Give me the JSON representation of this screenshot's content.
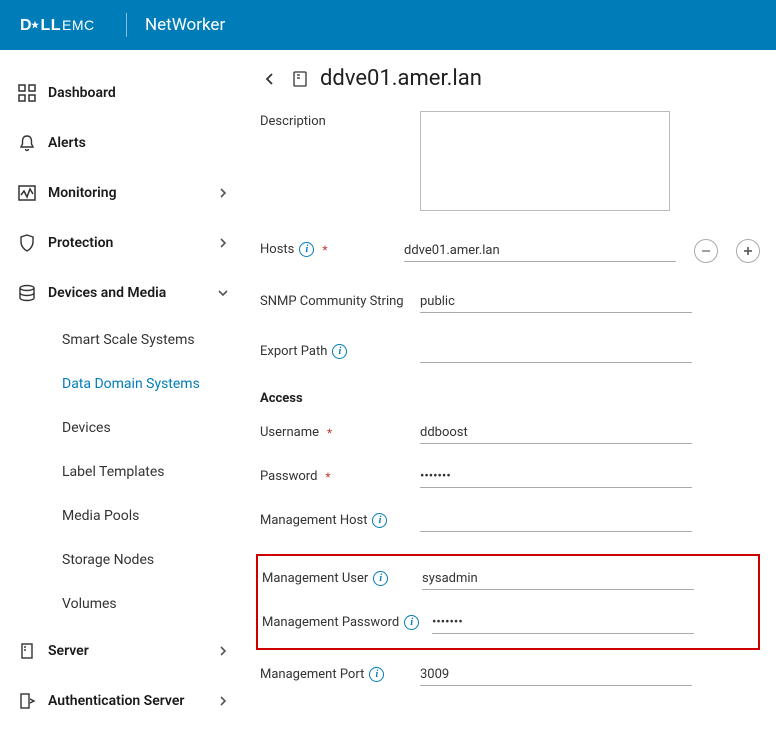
{
  "header": {
    "brand_main": "D",
    "brand_rest": "LLEMC",
    "product": "NetWorker"
  },
  "sidebar": {
    "items": [
      {
        "label": "Dashboard",
        "expandable": false
      },
      {
        "label": "Alerts",
        "expandable": false
      },
      {
        "label": "Monitoring",
        "expandable": true
      },
      {
        "label": "Protection",
        "expandable": true
      },
      {
        "label": "Devices and Media",
        "expandable": true,
        "expanded": true
      },
      {
        "label": "Server",
        "expandable": true
      },
      {
        "label": "Authentication Server",
        "expandable": true
      }
    ],
    "devices_sub": [
      "Smart Scale Systems",
      "Data Domain Systems",
      "Devices",
      "Label Templates",
      "Media Pools",
      "Storage Nodes",
      "Volumes"
    ],
    "active_sub": "Data Domain Systems"
  },
  "main": {
    "title": "ddve01.amer.lan",
    "form": {
      "description_label": "Description",
      "description_value": "",
      "hosts_label": "Hosts",
      "hosts_value": "ddve01.amer.lan",
      "snmp_label": "SNMP Community String",
      "snmp_value": "public",
      "export_label": "Export Path",
      "export_value": "",
      "access_section": "Access",
      "username_label": "Username",
      "username_value": "ddboost",
      "password_label": "Password",
      "password_value": "•••••••",
      "mgmt_host_label": "Management Host",
      "mgmt_host_value": "",
      "mgmt_user_label": "Management User",
      "mgmt_user_value": "sysadmin",
      "mgmt_pwd_label": "Management Password",
      "mgmt_pwd_value": "•••••••",
      "mgmt_port_label": "Management Port",
      "mgmt_port_value": "3009"
    }
  }
}
